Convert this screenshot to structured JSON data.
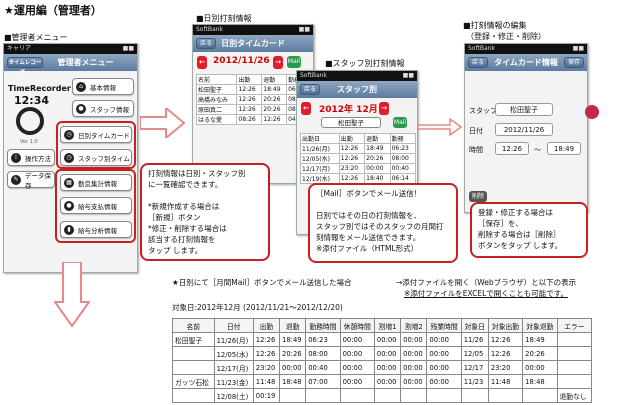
{
  "heading": "★運用編（管理者）",
  "labels": {
    "admin_menu": "■管理者メニュー",
    "daily": "■日別打刻情報",
    "staff": "■スタッフ別打刻情報",
    "edit": "■打刻情報の編集",
    "edit_sub": "（登録・修正・削除）"
  },
  "admin": {
    "carrier": "キャリア",
    "title": "管理者メニュー",
    "back": "タイムレコーダー",
    "logo": "TimeRecorder",
    "clock": "12:34",
    "version": "Ver 1.0",
    "buttons": [
      "基本情報",
      "スタッフ情報",
      "日別タイムカード",
      "スタッフ別タイム",
      "勤怠集計情報",
      "給与支払情報",
      "給与分析情報"
    ],
    "side": [
      "操作方法",
      "データ保存"
    ]
  },
  "daily": {
    "carrier": "SoftBank",
    "title": "日別タイムカード",
    "back": "戻る",
    "date": "2012/11/26",
    "mail": "Mail",
    "hdr": [
      "名前",
      "出勤",
      "退勤",
      "勤務"
    ],
    "rows": [
      [
        "松田聖子",
        "12:26",
        "18:49",
        "06:23"
      ],
      [
        "高橋みなみ",
        "12:26",
        "20:26",
        "08:00"
      ],
      [
        "原田真二",
        "12:26",
        "20:26",
        "08:00"
      ],
      [
        "はるな愛",
        "08:26",
        "12:26",
        "04:00"
      ]
    ]
  },
  "staff": {
    "carrier": "SoftBank",
    "title": "スタッフ別",
    "back": "戻る",
    "month": "2012年 12月",
    "name": "松田聖子",
    "mail": "Mail",
    "hdr": [
      "出勤日",
      "出勤",
      "退勤",
      "勤務"
    ],
    "rows": [
      [
        "11/26(月)",
        "12:26",
        "18:49",
        "06:23"
      ],
      [
        "12/05(水)",
        "12:26",
        "20:26",
        "08:00"
      ],
      [
        "12/17(月)",
        "23:20",
        "00:00",
        "00:40"
      ],
      [
        "12/19(水)",
        "12:26",
        "18:40",
        "06:14"
      ]
    ]
  },
  "edit": {
    "carrier": "SoftBank",
    "title": "タイムカード情報",
    "back": "戻る",
    "save": "保存",
    "staff_label": "スタッフ",
    "staff_val": "松田聖子",
    "date_label": "日付",
    "date_val": "2012/11/26",
    "time_label": "時間",
    "in": "12:26",
    "tilde": "〜",
    "out": "18:49",
    "del": "削除"
  },
  "callouts": {
    "c1": [
      "打刻情報は日別・スタッフ別",
      "に一覧確認できます。",
      "",
      "*新規作成する場合は",
      "［新規］ボタン",
      "*修正・削除する場合は",
      "該当する打刻情報を",
      "タップ します。"
    ],
    "c2": [
      "［Mail］ボタンでメール送信！",
      "",
      "日別ではその日の打刻情報を、",
      "スタッフ別ではそのスタッフの月間打",
      "刻情報をメール送信できます。",
      "※添付ファイル（HTML形式）"
    ],
    "c3": [
      "登録・修正する場合は",
      "［保存］を、",
      "削除する場合は［削除］",
      "ボタンをタップ します。"
    ]
  },
  "mail_note": "★日別にて［月間Mail］ボタンでメール送信した場合",
  "attach_note": [
    "→添付ファイルを開く（Webブラウザ）と以下の表示",
    "※添付ファイルをEXCELで開くことも可能です。"
  ],
  "period": "対象日:2012年12月 (2012/11/21〜2012/12/20)",
  "table": {
    "headers": [
      "名前",
      "日付",
      "出勤",
      "退勤",
      "勤務時間",
      "休憩時間",
      "割増1",
      "割増2",
      "残業時間",
      "対象日",
      "対象出勤",
      "対象退勤",
      "エラー"
    ],
    "rows": [
      [
        "松田聖子",
        "11/26(月)",
        "12:26",
        "18:49",
        "06:23",
        "00:00",
        "00:00",
        "00:00",
        "00:00",
        "11/26",
        "12:26",
        "18:49",
        ""
      ],
      [
        "",
        "12/05(水)",
        "12:26",
        "20:26",
        "08:00",
        "00:00",
        "00:00",
        "00:00",
        "00:00",
        "12/05",
        "12:26",
        "20:26",
        ""
      ],
      [
        "",
        "12/17(月)",
        "23:20",
        "00:00",
        "00:40",
        "00:00",
        "00:00",
        "00:00",
        "00:00",
        "12/17",
        "23:20",
        "00:00",
        ""
      ],
      [
        "ガッツ石松",
        "11/23(金)",
        "11:48",
        "18:48",
        "07:00",
        "00:00",
        "00:00",
        "00:00",
        "00:00",
        "11/23",
        "11:48",
        "18:48",
        ""
      ],
      [
        "",
        "12/08(土)",
        "00:19",
        "",
        "",
        "",
        "",
        "",
        "",
        "",
        "",
        "",
        "退勤なし"
      ]
    ]
  }
}
